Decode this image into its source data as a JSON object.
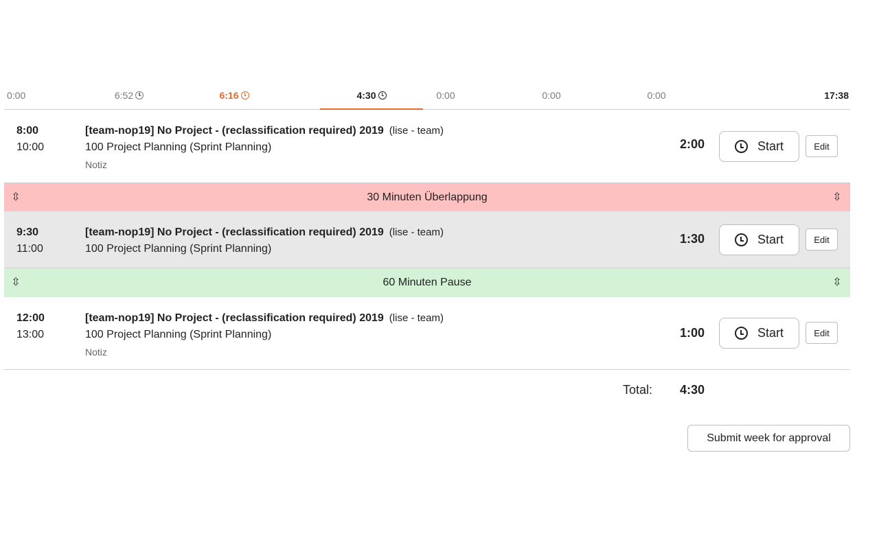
{
  "days": {
    "d0": "0:00",
    "d1": "6:52",
    "d2": "6:16",
    "d3": "4:30",
    "d4": "0:00",
    "d5": "0:00",
    "d6": "0:00",
    "week_total": "17:38"
  },
  "entries": [
    {
      "start": "8:00",
      "end": "10:00",
      "title": "[team-nop19] No Project - (reclassification required) 2019",
      "org": "(lise - team)",
      "task": "100 Project Planning (Sprint Planning)",
      "note": "Notiz",
      "duration": "2:00",
      "start_label": "Start",
      "edit_label": "Edit"
    },
    {
      "start": "9:30",
      "end": "11:00",
      "title": "[team-nop19] No Project - (reclassification required) 2019",
      "org": "(lise - team)",
      "task": "100 Project Planning (Sprint Planning)",
      "duration": "1:30",
      "start_label": "Start",
      "edit_label": "Edit"
    },
    {
      "start": "12:00",
      "end": "13:00",
      "title": "[team-nop19] No Project - (reclassification required) 2019",
      "org": "(lise - team)",
      "task": "100 Project Planning (Sprint Planning)",
      "note": "Notiz",
      "duration": "1:00",
      "start_label": "Start",
      "edit_label": "Edit"
    }
  ],
  "gaps": {
    "overlap": "30 Minuten Überlappung",
    "pause": "60 Minuten Pause",
    "arrow_glyph": "⇳"
  },
  "total": {
    "label": "Total:",
    "value": "4:30"
  },
  "submit_label": "Submit week for approval",
  "colors": {
    "accent": "#e8682a",
    "overlap_bg": "#fec1c1",
    "pause_bg": "#d4f3d6",
    "selected_entry_bg": "#e8e8e8"
  }
}
